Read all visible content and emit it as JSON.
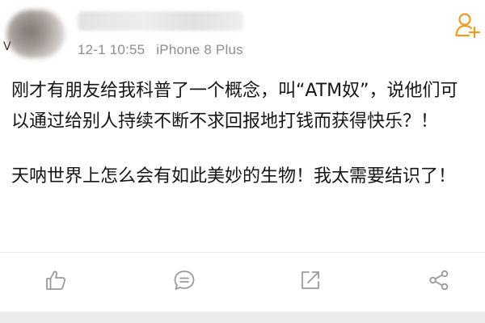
{
  "post": {
    "author": {
      "avatar_icon": "avatar-icon",
      "badge_letter": "V"
    },
    "meta": {
      "date_time": "12-1 10:55",
      "source": "iPhone 8 Plus"
    },
    "content": {
      "paragraph1": "刚才有朋友给我科普了一个概念，叫“ATM奴”，说他们可以通过给别人持续不断不求回报地打钱而获得快乐？！",
      "paragraph2": "天呐世界上怎么会有如此美妙的生物！我太需要结识了！"
    },
    "actions": {
      "follow_icon": "add-user-icon",
      "like_icon": "thumbs-up-icon",
      "comment_icon": "comment-icon",
      "repost_icon": "repost-icon",
      "share_icon": "share-icon"
    }
  },
  "colors": {
    "accent": "#f09a1f",
    "meta_text": "#8e8e8e",
    "body_text": "#151515",
    "icon_gray": "#9a9a9a",
    "divider": "#ececec"
  }
}
